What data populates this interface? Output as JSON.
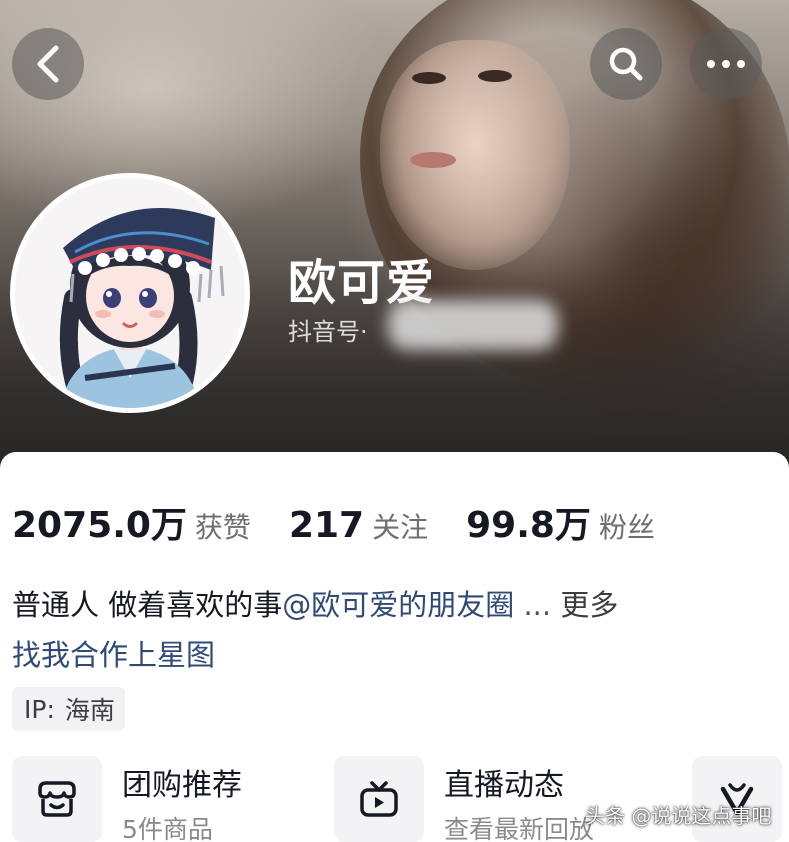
{
  "header": {
    "back_icon": "chevron-left-icon",
    "search_icon": "search-icon",
    "more_icon": "more-horizontal-icon"
  },
  "profile": {
    "nickname": "欧可爱",
    "douyin_id_label": "抖音号·"
  },
  "stats": [
    {
      "value": "2075.0万",
      "label": "获赞"
    },
    {
      "value": "217",
      "label": "关注"
    },
    {
      "value": "99.8万",
      "label": "粉丝"
    }
  ],
  "bio": {
    "text": "普通人 做着喜欢的事",
    "mention": "@欧可爱的朋友圈",
    "ellipsis": " ... ",
    "more": "更多",
    "cooperation": "找我合作上星图"
  },
  "ip": {
    "label": "IP:",
    "value": "海南"
  },
  "features": [
    {
      "title": "团购推荐",
      "subtitle": "5件商品",
      "icon": "shop-basket-icon"
    },
    {
      "title": "直播动态",
      "subtitle": "查看最新回放",
      "icon": "tv-icon"
    },
    {
      "icon": "v-badge-icon"
    }
  ],
  "watermark": "头条 @说说这点事吧",
  "colors": {
    "mention_blue": "#2f4a77",
    "text_primary": "#161823",
    "text_secondary": "#6e6f75"
  }
}
